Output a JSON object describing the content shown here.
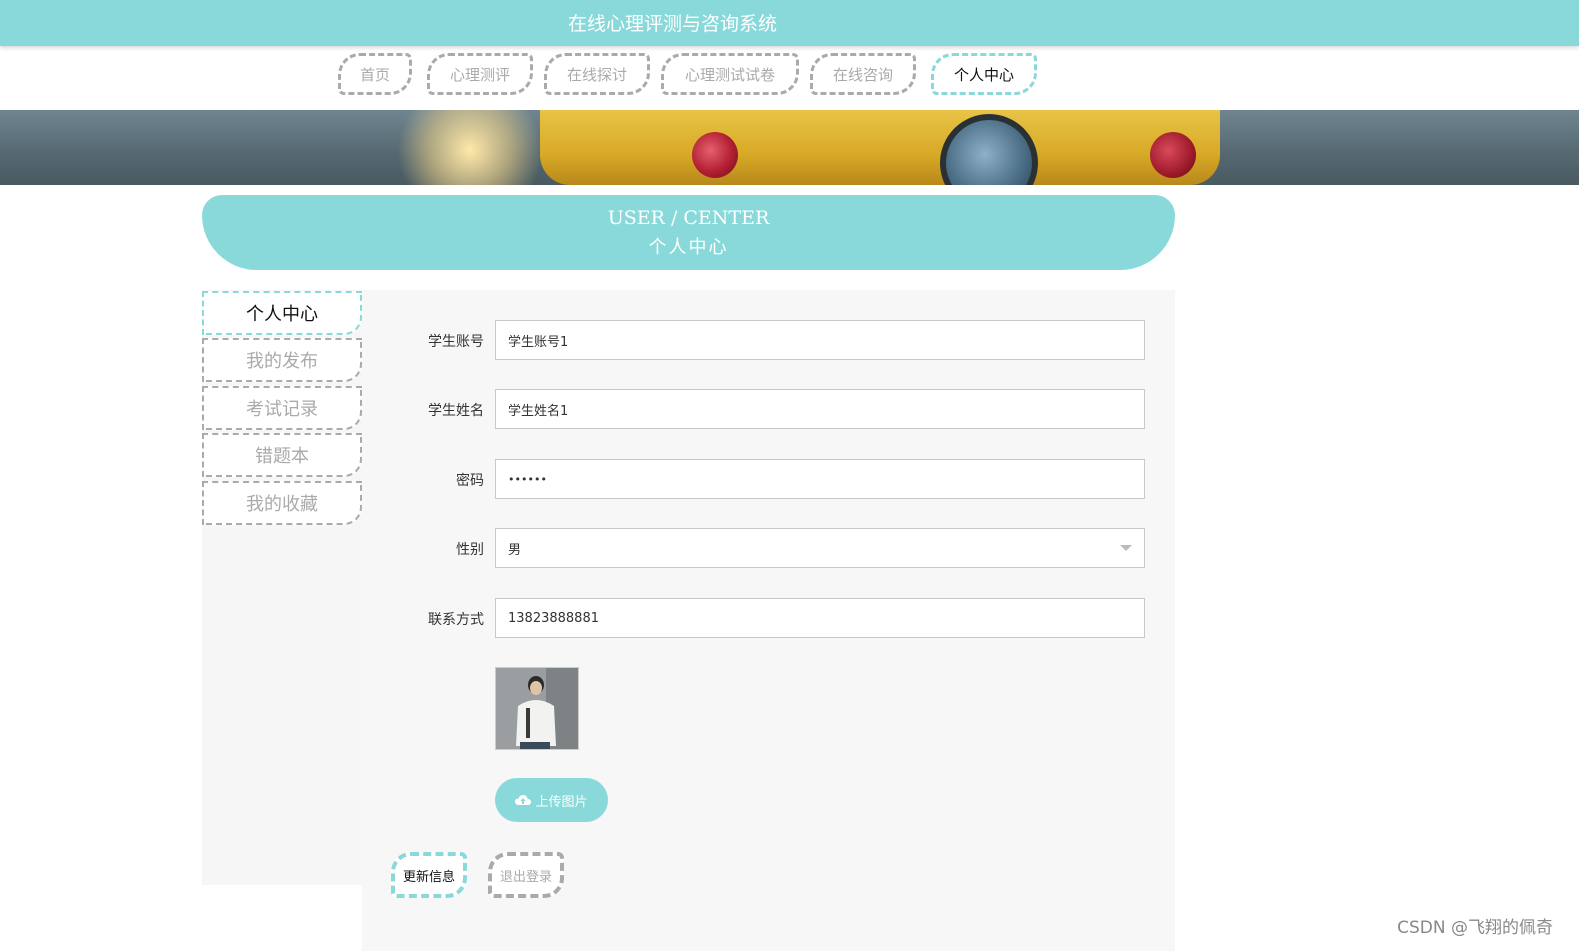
{
  "header": {
    "title": "在线心理评测与咨询系统"
  },
  "nav": {
    "items": [
      {
        "label": "首页"
      },
      {
        "label": "心理测评"
      },
      {
        "label": "在线探讨"
      },
      {
        "label": "心理测试试卷"
      },
      {
        "label": "在线咨询"
      },
      {
        "label": "个人中心"
      }
    ],
    "active": "个人中心"
  },
  "center_header": {
    "en": "USER / CENTER",
    "cn": "个人中心"
  },
  "sidebar": {
    "items": [
      {
        "label": "个人中心"
      },
      {
        "label": "我的发布"
      },
      {
        "label": "考试记录"
      },
      {
        "label": "错题本"
      },
      {
        "label": "我的收藏"
      }
    ],
    "active": "个人中心"
  },
  "form": {
    "account": {
      "label": "学生账号",
      "value": "学生账号1"
    },
    "name": {
      "label": "学生姓名",
      "value": "学生姓名1"
    },
    "password": {
      "label": "密码",
      "value": "••••••"
    },
    "gender": {
      "label": "性别",
      "value": "男"
    },
    "phone": {
      "label": "联系方式",
      "value": "13823888881"
    },
    "upload_label": "上传图片",
    "update_label": "更新信息",
    "logout_label": "退出登录"
  },
  "colors": {
    "accent": "#8ad9da",
    "inactive": "#aaaaaa"
  },
  "watermark": "CSDN @飞翔的佩奇"
}
